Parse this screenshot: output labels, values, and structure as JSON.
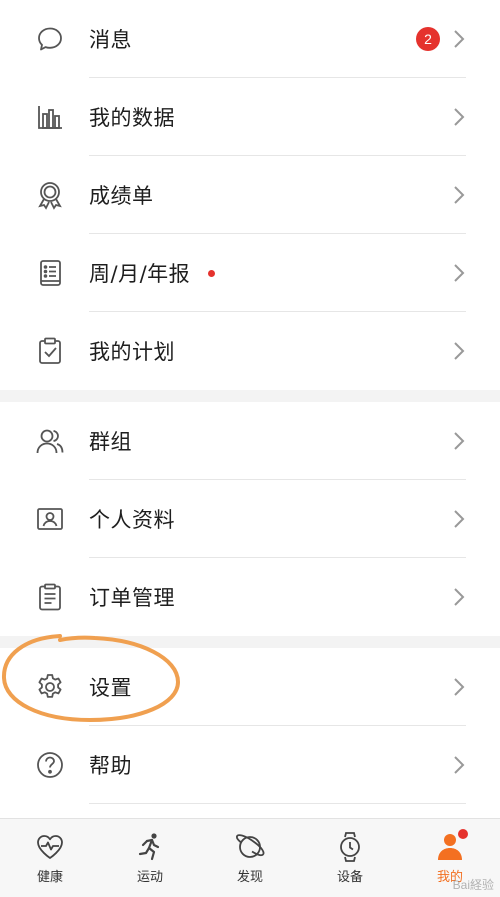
{
  "menu": {
    "group1": [
      {
        "label": "消息",
        "icon": "message-bubble-icon",
        "badge": "2"
      },
      {
        "label": "我的数据",
        "icon": "bar-chart-icon"
      },
      {
        "label": "成绩单",
        "icon": "medal-icon"
      },
      {
        "label": "周/月/年报",
        "icon": "report-book-icon",
        "dot": true
      },
      {
        "label": "我的计划",
        "icon": "clipboard-check-icon"
      }
    ],
    "group2": [
      {
        "label": "群组",
        "icon": "group-users-icon"
      },
      {
        "label": "个人资料",
        "icon": "profile-card-icon"
      },
      {
        "label": "订单管理",
        "icon": "order-list-icon"
      }
    ],
    "group3": [
      {
        "label": "设置",
        "icon": "gear-icon"
      },
      {
        "label": "帮助",
        "icon": "help-circle-icon"
      }
    ]
  },
  "tabbar": {
    "items": [
      {
        "label": "健康",
        "icon": "heart-pulse-icon"
      },
      {
        "label": "运动",
        "icon": "runner-icon"
      },
      {
        "label": "发现",
        "icon": "planet-icon"
      },
      {
        "label": "设备",
        "icon": "watch-icon"
      },
      {
        "label": "我的",
        "icon": "user-icon",
        "active": true
      }
    ]
  },
  "watermark": "Bai経验",
  "colors": {
    "accent": "#f37021",
    "badge": "#e5322d",
    "annotation": "#f0a050",
    "icon": "#555555"
  }
}
